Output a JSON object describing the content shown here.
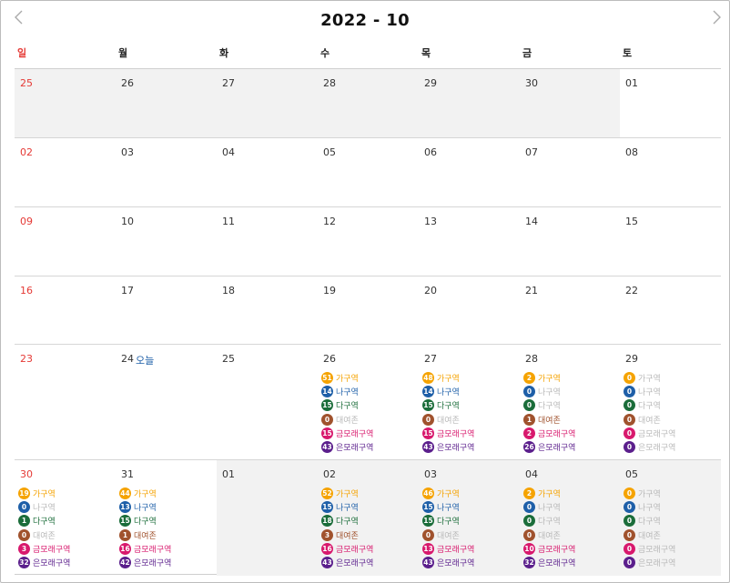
{
  "header": {
    "title": "2022 - 10",
    "prev_icon": "chevron-left-icon",
    "next_icon": "chevron-right-icon"
  },
  "weekdays": [
    "일",
    "월",
    "화",
    "수",
    "목",
    "금",
    "토"
  ],
  "colors": {
    "sunday": "#e53935",
    "today_label": "#1e5fa8",
    "outside_month_bg": "#f2f2f2",
    "stations": [
      "#f5a300",
      "#1e5fa8",
      "#1b6d3a",
      "#a0522d",
      "#d8196d",
      "#5b1f8c"
    ]
  },
  "stations": [
    "가구역",
    "나구역",
    "다구역",
    "대여존",
    "금모래구역",
    "은모래구역"
  ],
  "today_label": "오늘",
  "weeks": [
    [
      {
        "day": "25",
        "dim": true
      },
      {
        "day": "26",
        "dim": true
      },
      {
        "day": "27",
        "dim": true
      },
      {
        "day": "28",
        "dim": true
      },
      {
        "day": "29",
        "dim": true
      },
      {
        "day": "30",
        "dim": true
      },
      {
        "day": "01"
      }
    ],
    [
      {
        "day": "02"
      },
      {
        "day": "03"
      },
      {
        "day": "04"
      },
      {
        "day": "05"
      },
      {
        "day": "06"
      },
      {
        "day": "07"
      },
      {
        "day": "08"
      }
    ],
    [
      {
        "day": "09"
      },
      {
        "day": "10"
      },
      {
        "day": "11"
      },
      {
        "day": "12"
      },
      {
        "day": "13"
      },
      {
        "day": "14"
      },
      {
        "day": "15"
      }
    ],
    [
      {
        "day": "16"
      },
      {
        "day": "17"
      },
      {
        "day": "18"
      },
      {
        "day": "19"
      },
      {
        "day": "20"
      },
      {
        "day": "21"
      },
      {
        "day": "22"
      }
    ],
    [
      {
        "day": "23"
      },
      {
        "day": "24",
        "today": true
      },
      {
        "day": "25"
      },
      {
        "day": "26",
        "counts": [
          "51",
          "14",
          "15",
          "0",
          "15",
          "43"
        ]
      },
      {
        "day": "27",
        "counts": [
          "48",
          "14",
          "15",
          "0",
          "15",
          "43"
        ]
      },
      {
        "day": "28",
        "counts": [
          "2",
          "0",
          "0",
          "1",
          "2",
          "26"
        ]
      },
      {
        "day": "29",
        "counts": [
          "0",
          "0",
          "0",
          "0",
          "0",
          "0"
        ]
      }
    ],
    [
      {
        "day": "30",
        "counts": [
          "19",
          "0",
          "1",
          "0",
          "3",
          "32"
        ]
      },
      {
        "day": "31",
        "counts": [
          "44",
          "13",
          "15",
          "1",
          "16",
          "42"
        ]
      },
      {
        "day": "01",
        "dim": true
      },
      {
        "day": "02",
        "dim": true,
        "counts": [
          "52",
          "15",
          "18",
          "3",
          "16",
          "43"
        ]
      },
      {
        "day": "03",
        "dim": true,
        "counts": [
          "46",
          "15",
          "15",
          "0",
          "13",
          "43"
        ]
      },
      {
        "day": "04",
        "dim": true,
        "counts": [
          "2",
          "0",
          "0",
          "0",
          "10",
          "32"
        ]
      },
      {
        "day": "05",
        "dim": true,
        "counts": [
          "0",
          "0",
          "0",
          "0",
          "0",
          "0"
        ]
      }
    ]
  ]
}
